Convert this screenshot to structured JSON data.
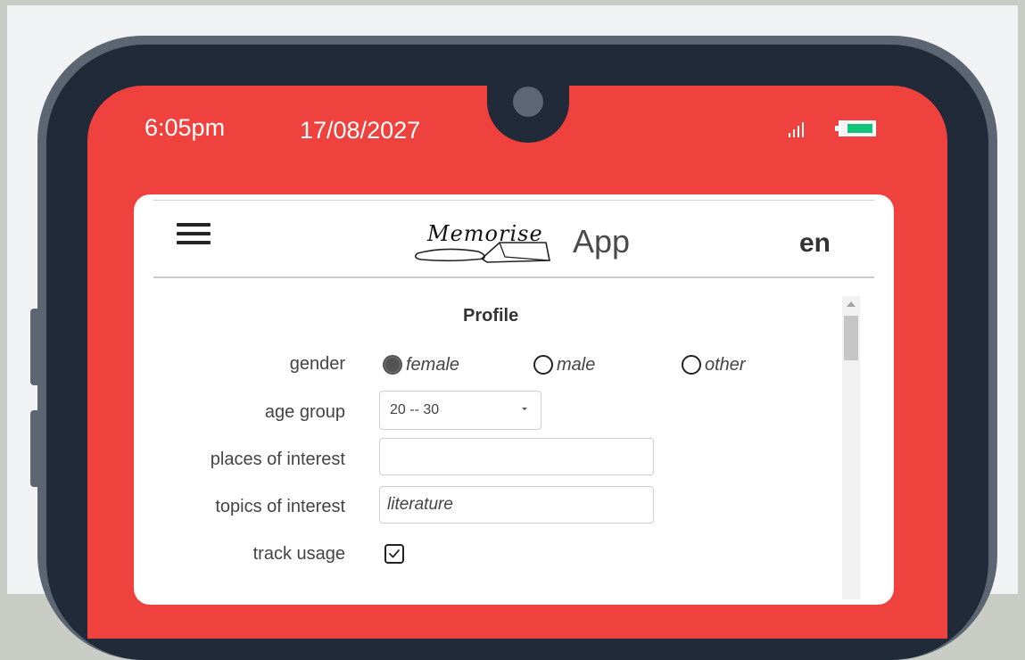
{
  "status_bar": {
    "time": "6:05pm",
    "date": "17/08/2027",
    "signal_icon": "signal-icon",
    "battery_icon": "battery-icon",
    "battery_color": "#14c37a"
  },
  "header": {
    "menu_icon": "hamburger-menu-icon",
    "logo_text": "Memorise",
    "title": "App",
    "language": "en"
  },
  "profile": {
    "title": "Profile",
    "gender": {
      "label": "gender",
      "options": [
        "female",
        "male",
        "other"
      ],
      "selected": "female"
    },
    "age_group": {
      "label": "age group",
      "value": "20 -- 30"
    },
    "places_of_interest": {
      "label": "places of interest",
      "value": ""
    },
    "topics_of_interest": {
      "label": "topics of interest",
      "value": "literature"
    },
    "track_usage": {
      "label": "track usage",
      "checked": true
    }
  },
  "colors": {
    "accent": "#ef413d",
    "phone_body": "#212a38",
    "phone_frame": "#5c6572"
  }
}
